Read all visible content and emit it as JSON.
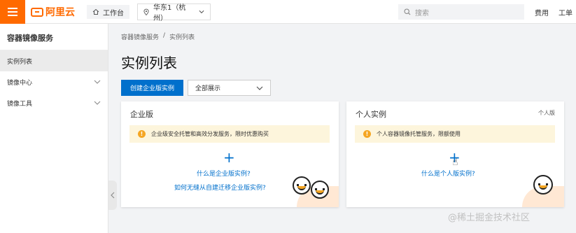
{
  "header": {
    "logo_text": "阿里云",
    "workbench_label": "工作台",
    "region_label": "华东1（杭州）",
    "search_placeholder": "搜索",
    "links": [
      "费用",
      "工单"
    ]
  },
  "sidebar": {
    "title": "容器镜像服务",
    "items": [
      {
        "label": "实例列表",
        "active": true,
        "expandable": false
      },
      {
        "label": "镜像中心",
        "active": false,
        "expandable": true
      },
      {
        "label": "镜像工具",
        "active": false,
        "expandable": true
      }
    ]
  },
  "breadcrumb": [
    "容器镜像服务",
    "/",
    "实例列表"
  ],
  "page_title": "实例列表",
  "toolbar": {
    "create_button": "创建企业版实例",
    "filter_select": "全部展示"
  },
  "cards": [
    {
      "title": "企业版",
      "tag": "",
      "notice": "企业级安全托管和高效分发服务，限时优惠购买",
      "links": [
        "什么是企业版实例?",
        "如何无缝从自建迁移企业版实例?"
      ]
    },
    {
      "title": "个人实例",
      "tag": "个人版",
      "notice": "个人容器镜像托管服务，限额使用",
      "links": [
        "什么是个人版实例?"
      ]
    }
  ],
  "watermark": "@稀土掘金技术社区",
  "colors": {
    "brand": "#ff6a00",
    "primary": "#0070cc",
    "notice_bg": "#fdf5dc",
    "warning": "#f5a623"
  },
  "icons": {
    "menu": "hamburger-icon",
    "home": "home-icon",
    "location": "location-pin-icon",
    "search": "search-icon",
    "warning": "warning-icon",
    "add": "plus-icon"
  }
}
